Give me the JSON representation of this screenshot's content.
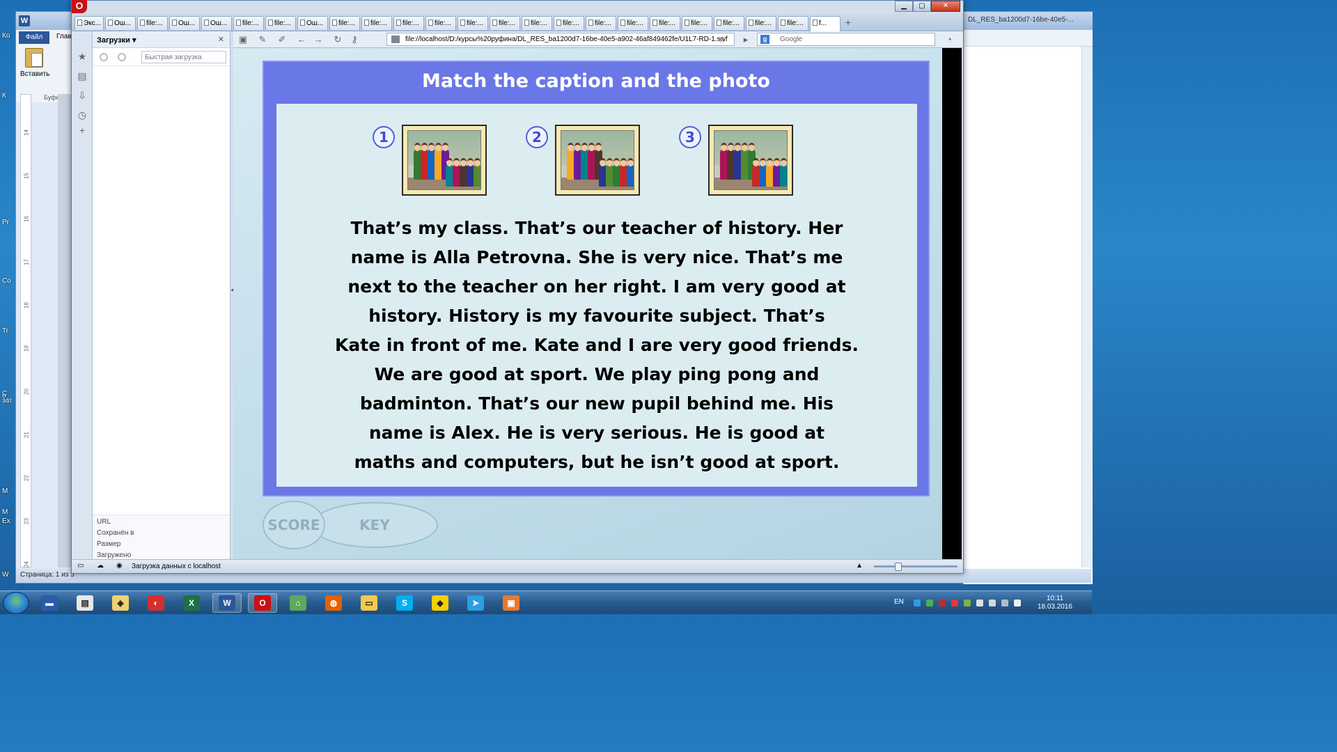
{
  "word": {
    "file_tab": "Файл",
    "home_tab_short": "Глав",
    "paste_label": "Вставить",
    "clipboard_group": "Буфер о",
    "right_title": "DL_RES_ba1200d7-16be-40e5-...",
    "status": "Страница: 1 из 5",
    "ruler_numbers": [
      "14",
      "15",
      "16",
      "17",
      "18",
      "19",
      "20",
      "21",
      "22",
      "23",
      "24"
    ]
  },
  "desktop_labels": [
    "Ко",
    "К",
    "Pr",
    "Co",
    "Tr",
    "С",
    "о",
    "зат",
    "М",
    "Ex",
    "M",
    "W"
  ],
  "opera": {
    "tabs": [
      "Экс...",
      "Ош...",
      "file:...",
      "Ош...",
      "Ош...",
      "file:...",
      "file:...",
      "Ош...",
      "file:...",
      "file:...",
      "file:...",
      "file:...",
      "file:...",
      "file:...",
      "file:...",
      "file:...",
      "file:...",
      "file:...",
      "file:...",
      "file:...",
      "file:...",
      "file:...",
      "file:...",
      "f..."
    ],
    "address": "file://localhost/D:/курсы%20руфина/DL_RES_ba1200d7-16be-40e5-a902-46af849462fe/U1L7-RD-1.swf",
    "search_placeholder": "Google",
    "panel_title": "Загрузки",
    "quick_download_placeholder": "Быстрая загрузка",
    "panel_info": [
      "URL",
      "Сохранён в",
      "Размер",
      "Загружено"
    ],
    "status_text": "Загрузка данных с localhost"
  },
  "exercise": {
    "title": "Match the caption and the photo",
    "photo_numbers": [
      "1",
      "2",
      "3"
    ],
    "caption_lines": [
      "That’s my class. That’s our teacher of history. Her",
      "name is Alla Petrovna. She is very nice. That’s me",
      "next to the teacher on her right. I am very good at",
      "history. History is my favourite subject. That’s",
      "Kate in front of me. Kate and I are very good friends.",
      "We are good at sport. We play ping pong and",
      "badminton. That’s our new pupil behind me. His",
      "name is Alex. He is very serious. He is good at",
      "maths and computers, but he isn’t good at sport."
    ],
    "score_label": "SCORE",
    "key_label": "KEY"
  },
  "taskbar": {
    "apps": [
      "save",
      "notepad",
      "paint",
      "acrobat-reader",
      "excel",
      "word",
      "opera",
      "network",
      "firefox",
      "explorer",
      "skype",
      "batman",
      "telegram",
      "pdf"
    ],
    "active_apps": [
      "word",
      "opera"
    ],
    "language": "EN",
    "time": "10:11",
    "date": "18.03.2016"
  },
  "colors": {
    "frame_blue": "#6a77e6",
    "inner_bg": "#dcedf1",
    "number_blue": "#3f4ed0",
    "photo_frame": "#f6e9b0"
  }
}
